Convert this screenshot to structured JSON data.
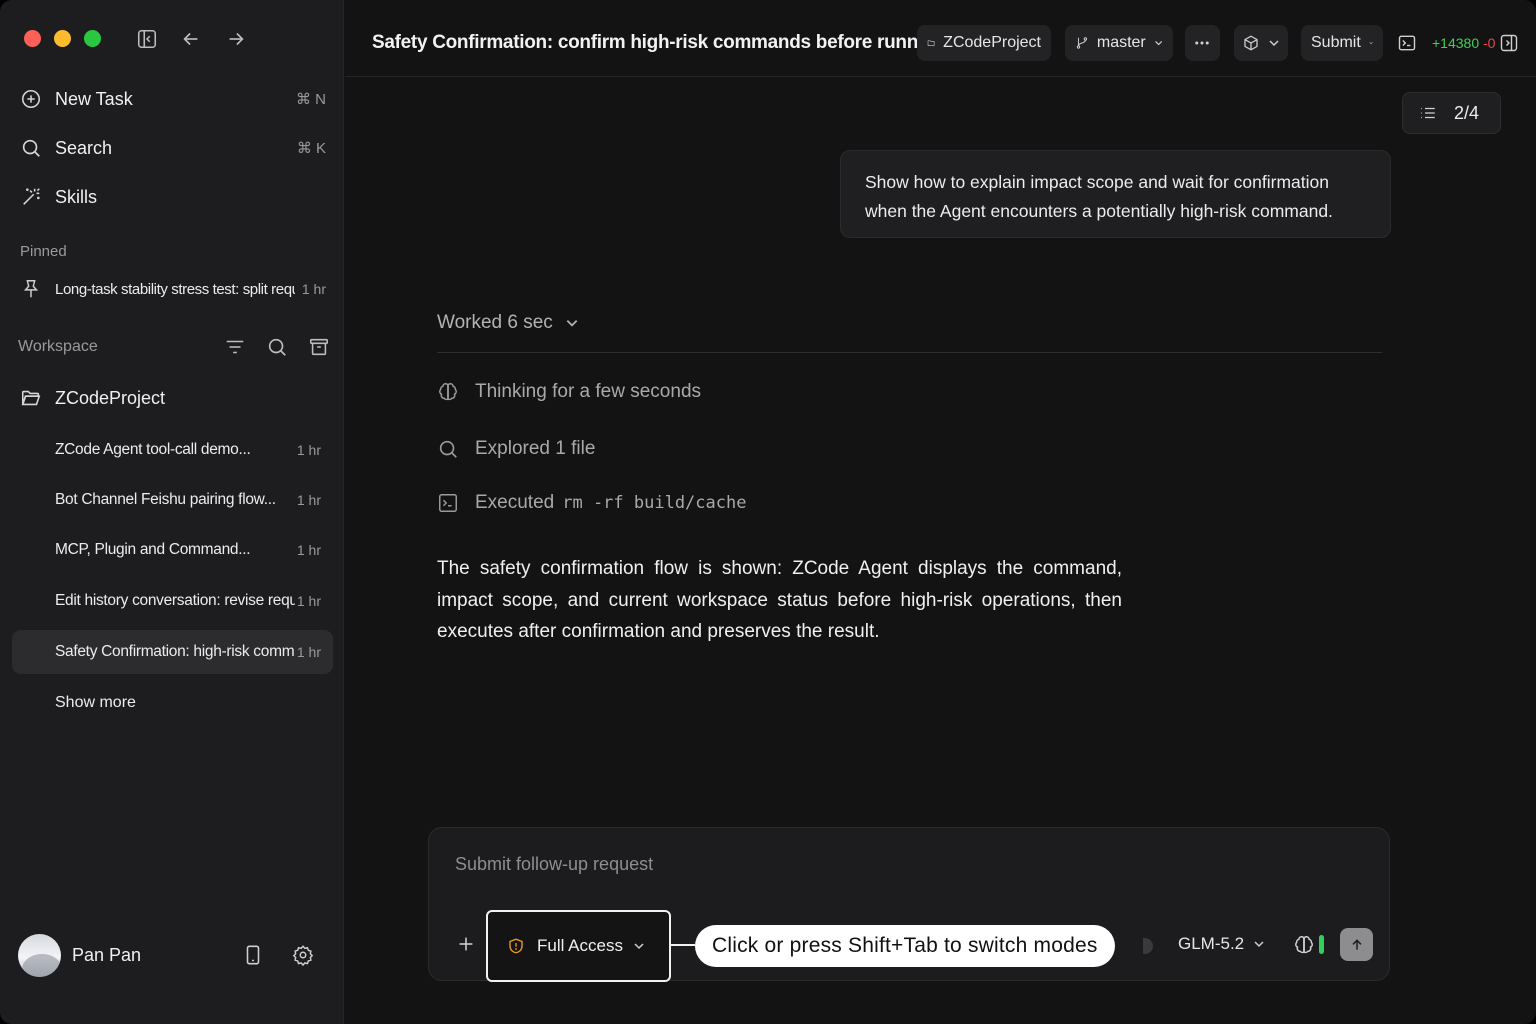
{
  "sidebar": {
    "nav": [
      {
        "label": "New Task",
        "shortcut": "⌘ N",
        "icon": "plus-circle-icon"
      },
      {
        "label": "Search",
        "shortcut": "⌘ K",
        "icon": "search-icon"
      },
      {
        "label": "Skills",
        "shortcut": "",
        "icon": "magic-wand-icon"
      }
    ],
    "pinned_label": "Pinned",
    "pinned": [
      {
        "title": "Long-task stability stress test: split requ...",
        "time": "1 hr"
      }
    ],
    "workspace_label": "Workspace",
    "project": "ZCodeProject",
    "tasks": [
      {
        "title": "ZCode Agent tool-call demo...",
        "time": "1 hr"
      },
      {
        "title": "Bot Channel Feishu pairing flow...",
        "time": "1 hr"
      },
      {
        "title": "MCP,  Plugin and Command...",
        "time": "1 hr"
      },
      {
        "title": "Edit history conversation: revise request...",
        "time": "1 hr"
      },
      {
        "title": "Safety Confirmation: high-risk command...",
        "time": "1 hr"
      }
    ],
    "active_task_index": 4,
    "show_more": "Show more",
    "user_name": "Pan Pan"
  },
  "topbar": {
    "title": "Safety Confirmation: confirm high-risk commands before running",
    "project_pill": "ZCodeProject",
    "branch": "master",
    "submit": "Submit",
    "diff_add": "+14380",
    "diff_del": "-0"
  },
  "pager": {
    "label": "2/4"
  },
  "conversation": {
    "user_message": "Show how to explain impact scope and wait for confirmation when the Agent encounters a potentially high-risk command.",
    "worked": "Worked 6 sec",
    "steps": [
      {
        "icon": "brain-icon",
        "text": "Thinking for a few seconds",
        "code": ""
      },
      {
        "icon": "search-icon",
        "text": "Explored 1 file",
        "code": ""
      },
      {
        "icon": "terminal-icon",
        "text": "Executed",
        "code": "rm -rf build/cache"
      }
    ],
    "answer": "The safety confirmation flow is shown: ZCode Agent displays the command, impact scope, and current workspace status before high-risk operations, then executes after confirmation and preserves the result."
  },
  "composer": {
    "placeholder": "Submit follow-up request",
    "access_mode": "Full Access",
    "callout": "Click or press Shift+Tab to switch modes",
    "model": "GLM-5.2"
  },
  "colors": {
    "accent_warning": "#f29b1c",
    "diff_add": "#3fcf5a",
    "diff_del": "#e5484d",
    "context_bar": "#2fd15c"
  }
}
